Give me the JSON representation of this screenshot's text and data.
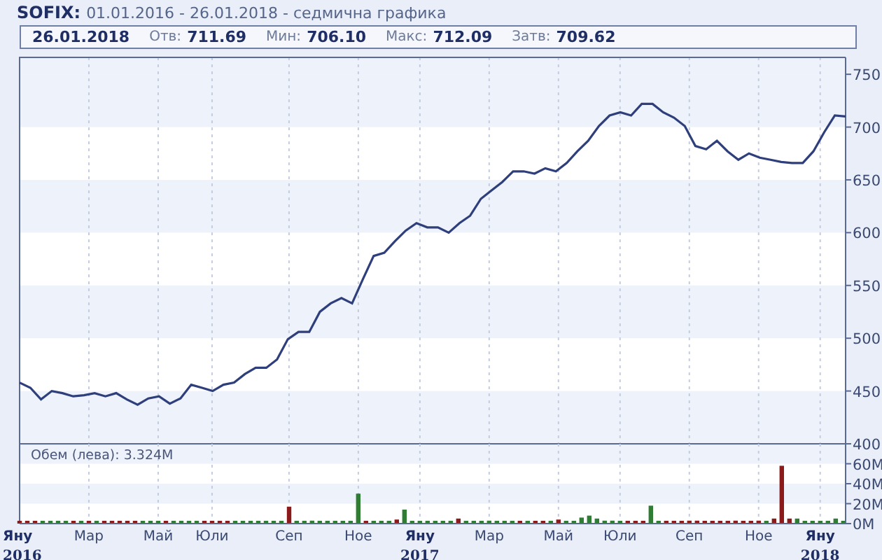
{
  "title": {
    "symbol": "SOFIX:",
    "range": "01.01.2016 - 26.01.2018 - седмична графика"
  },
  "quote": {
    "date": "26.01.2018",
    "fields": [
      {
        "label": "Отв:",
        "value": "711.69"
      },
      {
        "label": "Мин:",
        "value": "706.10"
      },
      {
        "label": "Макс:",
        "value": "712.09"
      },
      {
        "label": "Затв:",
        "value": "709.62"
      }
    ]
  },
  "price_chart": {
    "chart_data": {
      "type": "line",
      "grid": true,
      "ylim": [
        400,
        766
      ],
      "yticks": [
        400,
        450,
        500,
        550,
        600,
        650,
        700,
        750
      ],
      "categories": [
        null,
        null,
        null,
        null,
        null,
        null,
        null,
        null,
        null,
        null,
        null,
        null,
        null,
        null,
        null,
        null,
        null,
        null,
        null,
        null,
        null,
        null,
        null,
        null,
        null,
        null,
        null,
        null,
        null,
        null,
        null,
        null,
        null,
        null,
        null,
        null,
        null,
        null,
        null,
        null,
        null,
        null,
        null,
        null,
        null,
        null,
        null,
        null,
        null,
        null,
        null,
        null,
        null,
        null,
        null,
        null,
        null,
        null,
        null,
        null,
        null,
        null,
        null,
        null,
        null,
        null,
        null,
        null,
        null,
        null,
        null,
        null,
        null,
        null,
        null,
        null,
        null,
        null
      ],
      "series": [
        {
          "color": "#2e3f7c",
          "values": [
            458,
            453,
            442,
            450,
            448,
            445,
            446,
            448,
            445,
            448,
            442,
            437,
            443,
            445,
            438,
            443,
            456,
            453,
            450,
            456,
            458,
            466,
            472,
            472,
            480,
            499,
            506,
            506,
            525,
            533,
            538,
            533,
            556,
            578,
            581,
            592,
            602,
            609,
            605,
            605,
            600,
            609,
            616,
            632,
            640,
            648,
            658,
            658,
            656,
            661,
            658,
            666,
            677,
            687,
            701,
            711,
            714,
            711,
            722,
            722,
            714,
            709,
            701,
            682,
            679,
            687,
            677,
            669,
            675,
            671,
            669,
            667,
            666,
            666,
            677,
            695,
            711,
            710
          ]
        }
      ]
    }
  },
  "volume_chart": {
    "label": "Обем (лева): 3.324M",
    "chart_data": {
      "type": "bar",
      "grid": true,
      "ylim": [
        0,
        80
      ],
      "yticks": [
        {
          "value": 0,
          "label": "0M"
        },
        {
          "value": 20,
          "label": "20M"
        },
        {
          "value": 40,
          "label": "40M"
        },
        {
          "value": 60,
          "label": "60M"
        }
      ],
      "categories": [
        "Яну",
        null,
        null,
        null,
        null,
        null,
        null,
        null,
        null,
        "Мар",
        null,
        null,
        null,
        null,
        null,
        null,
        null,
        null,
        "Май",
        null,
        null,
        null,
        null,
        null,
        null,
        "Юли",
        null,
        null,
        null,
        null,
        null,
        null,
        null,
        null,
        null,
        "Сеп",
        null,
        null,
        null,
        null,
        null,
        null,
        null,
        null,
        "Ное",
        null,
        null,
        null,
        null,
        null,
        null,
        null,
        "Яну",
        null,
        null,
        null,
        null,
        null,
        null,
        null,
        null,
        "Мар",
        null,
        null,
        null,
        null,
        null,
        null,
        null,
        null,
        "Май",
        null,
        null,
        null,
        null,
        null,
        null,
        null,
        "Юли",
        null,
        null,
        null,
        null,
        null,
        null,
        null,
        null,
        "Сеп",
        null,
        null,
        null,
        null,
        null,
        null,
        null,
        null,
        "Ное",
        null,
        null,
        null,
        null,
        null,
        null,
        null,
        "Яну",
        null,
        null,
        null
      ],
      "series": [
        {
          "color": "#2e7d32",
          "values": [
            null,
            null,
            null,
            1,
            1,
            1,
            1,
            null,
            1,
            null,
            1,
            null,
            null,
            null,
            null,
            null,
            1,
            1,
            1,
            null,
            1,
            1,
            1,
            1,
            null,
            null,
            null,
            null,
            1,
            1,
            1,
            1,
            1,
            1,
            1,
            null,
            1,
            1,
            3,
            1,
            1,
            1,
            1,
            2,
            30,
            null,
            1,
            2,
            2,
            null,
            14,
            1,
            2,
            2,
            2,
            2,
            2,
            null,
            2,
            1,
            2,
            3,
            2,
            1,
            1,
            null,
            2,
            null,
            null,
            2,
            null,
            2,
            2,
            6,
            8,
            5,
            3,
            3,
            2,
            null,
            null,
            null,
            18,
            2,
            null,
            null,
            null,
            null,
            null,
            null,
            null,
            null,
            null,
            null,
            null,
            null,
            null,
            1,
            null,
            null,
            null,
            5,
            1,
            1,
            2,
            2,
            5,
            2
          ]
        },
        {
          "color": "#8b1a1a",
          "values": [
            1,
            1,
            1,
            null,
            null,
            null,
            null,
            1,
            null,
            1,
            null,
            1,
            1,
            1,
            2,
            1,
            null,
            null,
            null,
            1,
            null,
            null,
            null,
            null,
            1,
            1,
            2,
            2,
            null,
            null,
            null,
            null,
            null,
            null,
            null,
            17,
            null,
            null,
            null,
            null,
            null,
            null,
            null,
            null,
            null,
            1,
            null,
            null,
            null,
            4,
            null,
            null,
            null,
            null,
            null,
            null,
            null,
            5,
            null,
            null,
            null,
            null,
            null,
            null,
            null,
            2,
            null,
            1,
            1,
            null,
            4,
            null,
            null,
            null,
            null,
            null,
            null,
            null,
            null,
            1,
            2,
            2,
            null,
            null,
            1,
            1,
            2,
            3,
            3,
            2,
            1,
            1,
            1,
            3,
            2,
            1,
            3,
            null,
            5,
            58,
            5,
            null,
            null,
            null,
            null,
            null,
            null,
            null
          ]
        }
      ]
    },
    "years": [
      "2016",
      "2017",
      "2018"
    ]
  }
}
